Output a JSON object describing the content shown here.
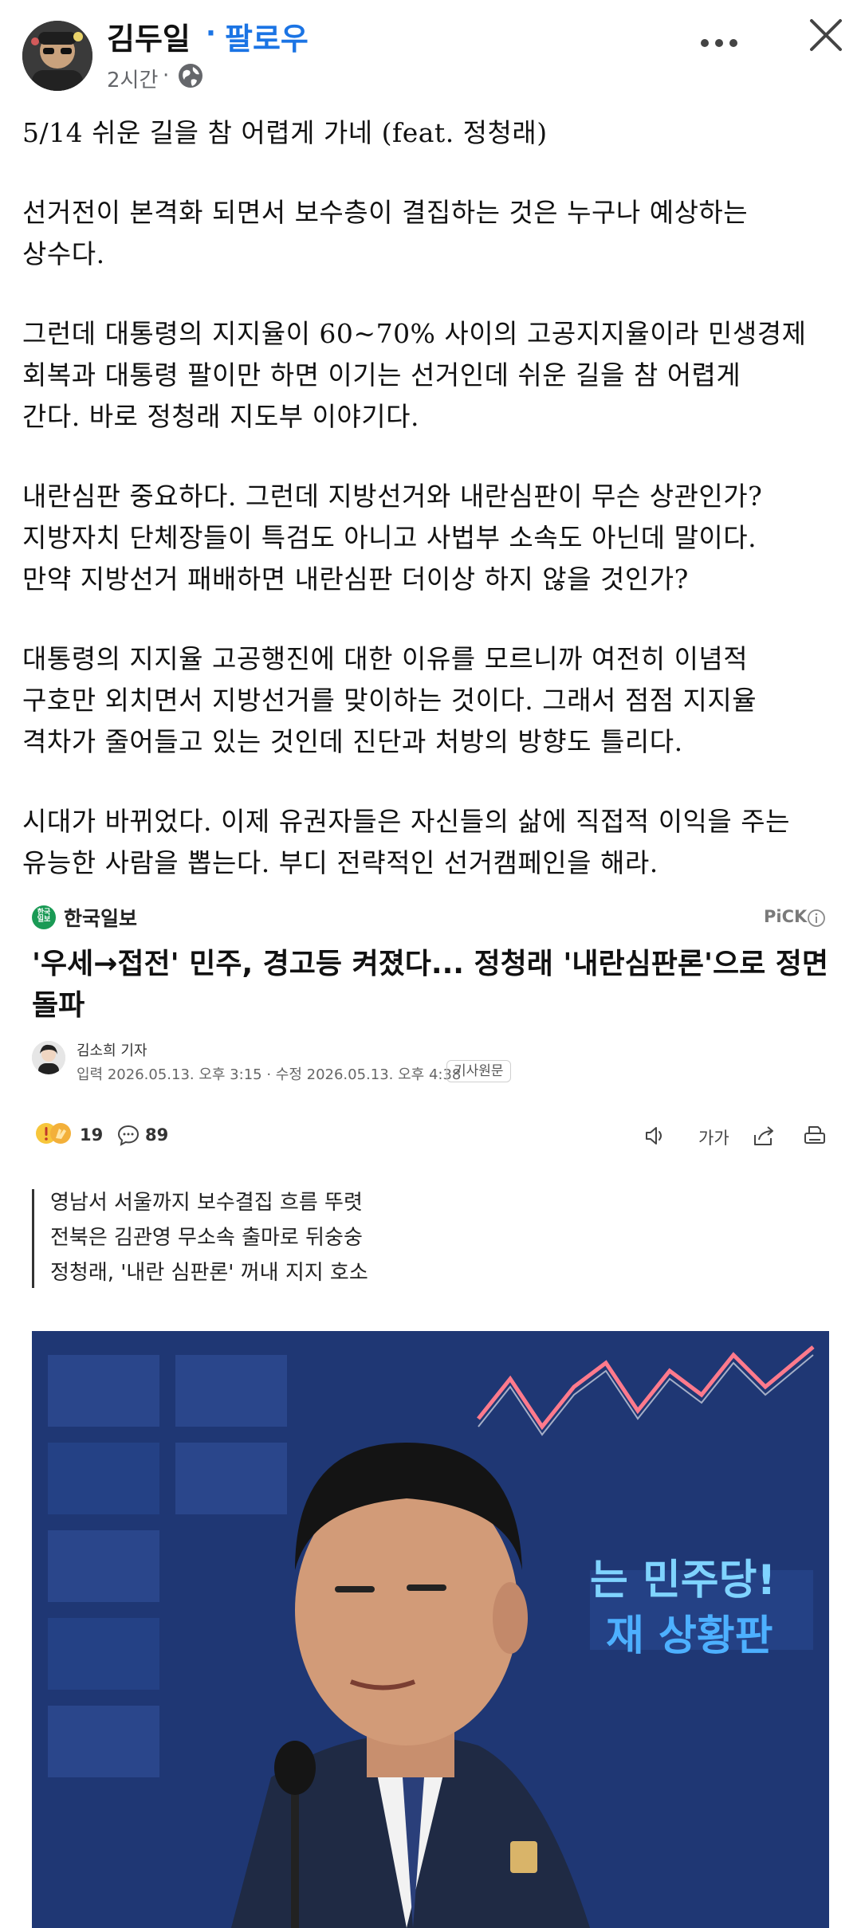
{
  "post": {
    "author": "김두일",
    "follow_sep": "·",
    "follow_label": "팔로우",
    "time": "2시간",
    "time_sep": "·",
    "lines": [
      "5/14 쉬운 길을 참 어렵게 가네 (feat. 정청래)",
      "",
      "선거전이 본격화 되면서 보수층이 결집하는 것은 누구나 예상하는",
      "상수다.",
      "",
      "그런데 대통령의 지지율이 60~70% 사이의 고공지지율이라 민생경제",
      "회복과 대통령 팔이만 하면 이기는 선거인데 쉬운 길을 참 어렵게",
      "간다. 바로 정청래 지도부 이야기다.",
      "",
      "내란심판 중요하다. 그런데 지방선거와 내란심판이 무슨 상관인가?",
      "지방자치 단체장들이 특검도 아니고 사법부 소속도 아닌데 말이다.",
      "만약 지방선거 패배하면 내란심판 더이상 하지 않을 것인가?",
      "",
      "대통령의 지지율 고공행진에 대한 이유를 모르니까 여전히 이념적",
      "구호만 외치면서 지방선거를 맞이하는 것이다. 그래서 점점 지지율",
      "격차가 줄어들고 있는 것인데 진단과 처방의 방향도 틀리다.",
      "",
      "시대가 바뀌었다. 이제 유권자들은 자신들의 삶에 직접적 이익을 주는",
      "유능한 사람을 뽑는다. 부디 전략적인 선거캠페인을 해라."
    ]
  },
  "article": {
    "publisher": "한국일보",
    "publisher_logo_text": "한국\n일보",
    "pick_label": "PiCK",
    "headline": "'우세→접전' 민주, 경고등 켜졌다... 정청래 '내란심판론'으로 정면돌파",
    "reporter": "김소희 기자",
    "dates": "입력 2026.05.13. 오후 3:15 · 수정 2026.05.13. 오후 4:38",
    "original_label": "기사원문",
    "reaction_count": "19",
    "comment_count": "89",
    "fontsize_label": "가가",
    "summary": [
      "영남서 서울까지 보수결집 흐름 뚜렷",
      "전북은 김관영 무소속 출마로 뒤숭숭",
      "정청래, '내란 심판론' 꺼내 지지 호소"
    ],
    "photo_banner_text": [
      "는 민주당!",
      "재 상황판"
    ]
  },
  "colors": {
    "accent": "#1b74e4",
    "publisher_green": "#1a9a55",
    "photo_bg": "#203a7c"
  }
}
